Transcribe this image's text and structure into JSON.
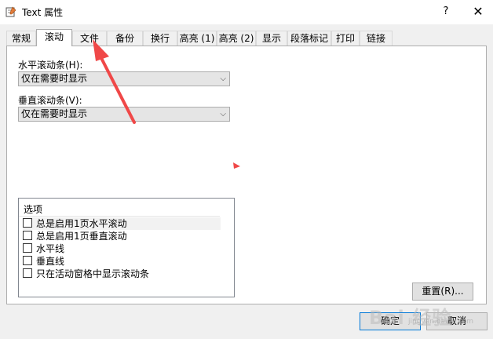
{
  "window": {
    "title": "Text 属性",
    "help": "?",
    "close": "✕"
  },
  "tabs": [
    "常规",
    "滚动",
    "文件",
    "备份",
    "换行",
    "高亮 (1)",
    "高亮 (2)",
    "显示",
    "段落标记",
    "打印",
    "链接"
  ],
  "active_tab": "滚动",
  "scroll": {
    "horizontal_label": "水平滚动条(H):",
    "horizontal_value": "仅在需要时显示",
    "vertical_label": "垂直滚动条(V):",
    "vertical_value": "仅在需要时显示"
  },
  "options": {
    "header": "选项",
    "items": [
      {
        "label": "总是启用1页水平滚动",
        "checked": false
      },
      {
        "label": "总是启用1页垂直滚动",
        "checked": false
      },
      {
        "label": "水平线",
        "checked": false
      },
      {
        "label": "垂直线",
        "checked": false
      },
      {
        "label": "只在活动窗格中显示滚动条",
        "checked": false
      }
    ]
  },
  "buttons": {
    "reset": "重置(R)...",
    "ok": "确定",
    "cancel": "取消"
  },
  "watermark": {
    "text": "Bai 经验",
    "sub": "jingyan.baidu.com"
  },
  "colors": {
    "annotation": "#f04848",
    "default_button_border": "#0078d7"
  }
}
